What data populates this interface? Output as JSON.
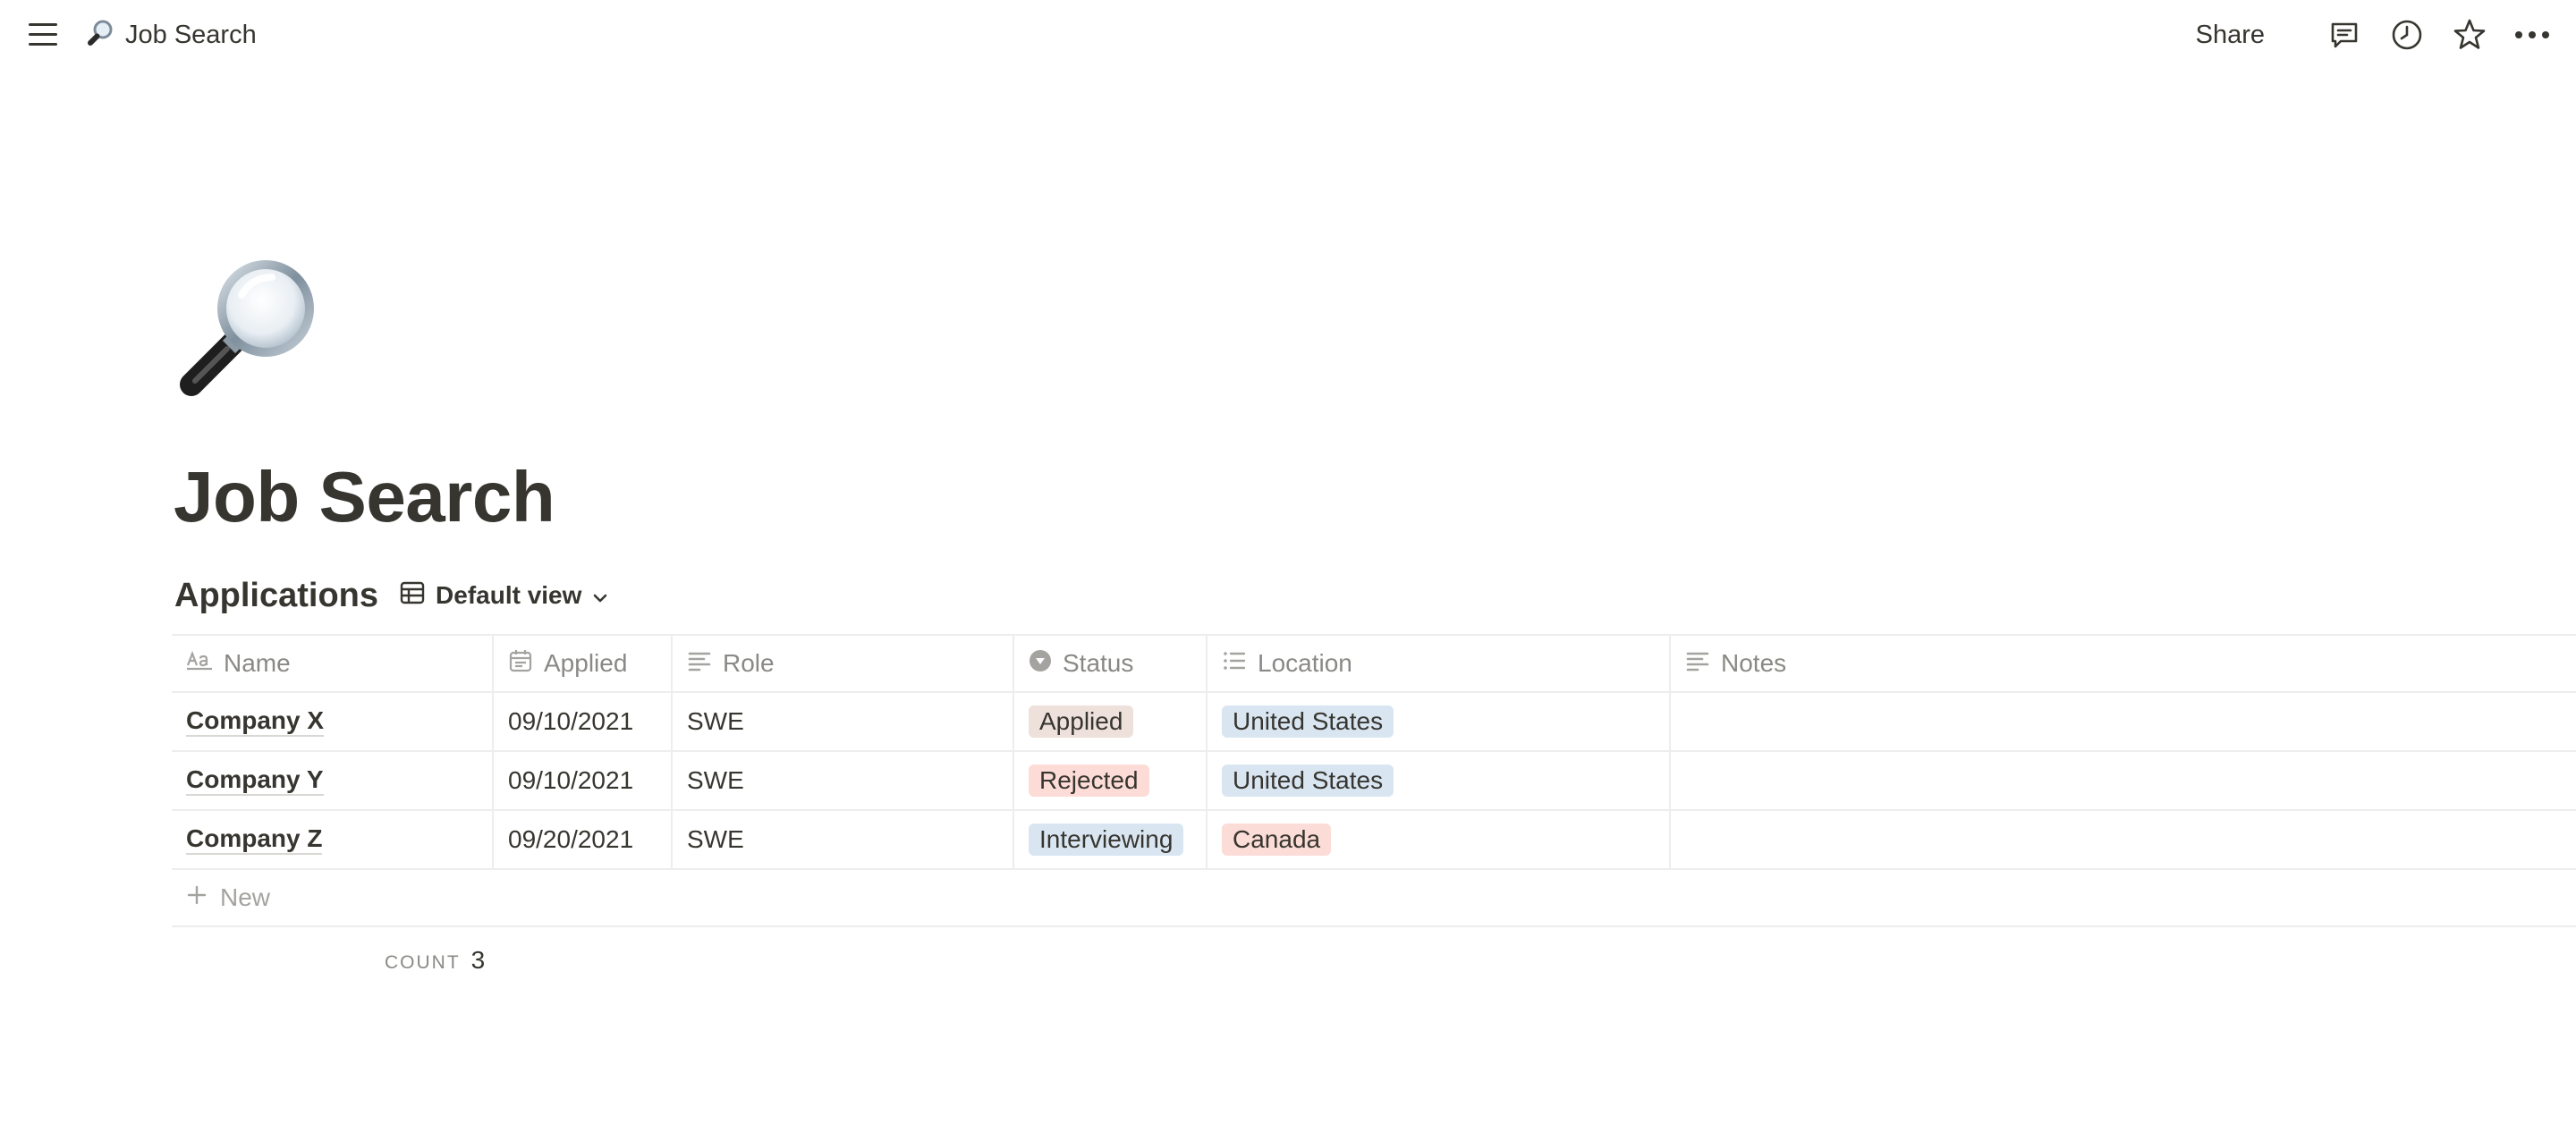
{
  "topbar": {
    "breadcrumb_title": "Job Search",
    "breadcrumb_icon": "magnifying-glass-emoji",
    "share_label": "Share",
    "icons": [
      "hamburger-menu-icon",
      "comment-icon",
      "clock-history-icon",
      "star-icon",
      "more-dots-icon"
    ]
  },
  "page": {
    "icon": "magnifying-glass-emoji",
    "title": "Job Search"
  },
  "database": {
    "title": "Applications",
    "view_label": "Default view",
    "columns": [
      {
        "label": "Name",
        "icon": "text-aa-icon"
      },
      {
        "label": "Applied",
        "icon": "calendar-icon"
      },
      {
        "label": "Role",
        "icon": "text-lines-icon"
      },
      {
        "label": "Status",
        "icon": "select-circle-icon"
      },
      {
        "label": "Location",
        "icon": "list-icon"
      },
      {
        "label": "Notes",
        "icon": "text-lines-icon"
      }
    ],
    "rows": [
      {
        "name": "Company X",
        "applied": "09/10/2021",
        "role": "SWE",
        "status": "Applied",
        "location": "United States",
        "notes": ""
      },
      {
        "name": "Company Y",
        "applied": "09/10/2021",
        "role": "SWE",
        "status": "Rejected",
        "location": "United States",
        "notes": ""
      },
      {
        "name": "Company Z",
        "applied": "09/20/2021",
        "role": "SWE",
        "status": "Interviewing",
        "location": "Canada",
        "notes": ""
      }
    ],
    "new_label": "New",
    "count_label": "COUNT",
    "count_value": "3"
  },
  "colors": {
    "text": "#37352f",
    "muted": "#8a8985",
    "border": "#ededec",
    "tag_applied": "#eee0da",
    "tag_rejected": "#fddcd8",
    "tag_interviewing": "#d9e6f2",
    "tag_united_states": "#d9e6f2",
    "tag_canada": "#fbdcd7"
  }
}
